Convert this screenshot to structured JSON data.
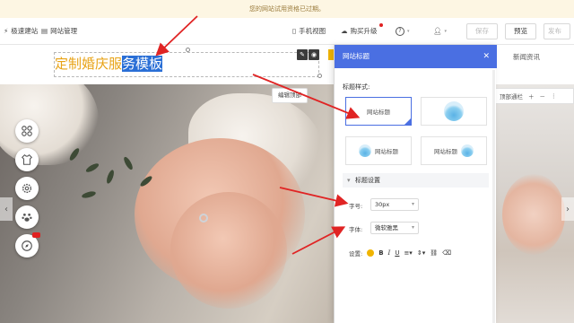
{
  "notice": "您的网站试用资格已过期。",
  "toolbar": {
    "quick_build": "极速建站",
    "site_manage": "网站管理",
    "mobile_view": "手机视图",
    "buy_upgrade": "购买升级",
    "help_icon": "?",
    "save": "保存",
    "preview": "预览",
    "publish": "发布"
  },
  "site": {
    "title_part1": "定制婚庆服",
    "title_part2": "务模板",
    "nav_news": "新闻资讯"
  },
  "hero": {
    "edit_style": "编辑顶部",
    "rp_toolbar_label": "顶部通栏"
  },
  "panel": {
    "title": "网站标题",
    "title_style_label": "标题样式:",
    "card_text": "网站标题",
    "section_label": "标题设置",
    "font_size_label": "字号:",
    "font_size_value": "30px",
    "font_family_label": "字体:",
    "font_family_value": "微软雅黑",
    "settings_label": "设置:",
    "accent": "#4a6fe2"
  }
}
